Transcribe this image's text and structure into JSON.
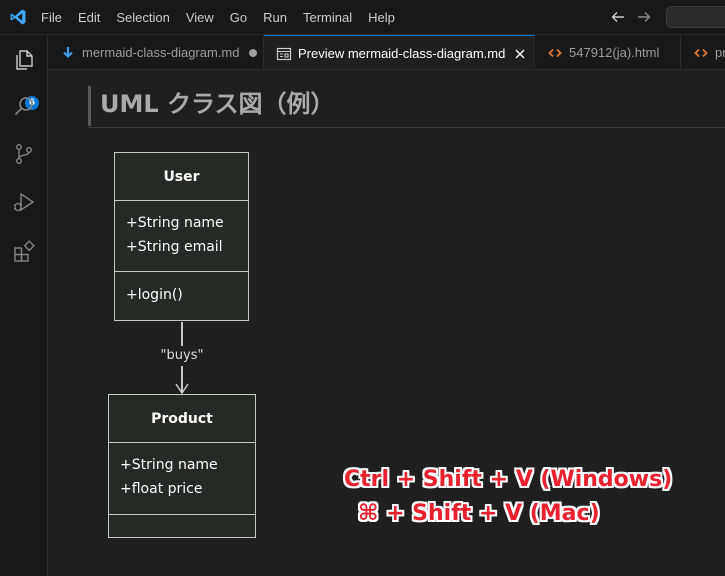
{
  "menu": [
    "File",
    "Edit",
    "Selection",
    "View",
    "Go",
    "Run",
    "Terminal",
    "Help"
  ],
  "activity": {
    "explorer_badge": "6",
    "icons": [
      "files-icon",
      "search-icon",
      "source-control-icon",
      "run-debug-icon",
      "extensions-icon"
    ]
  },
  "tabs": [
    {
      "label": "mermaid-class-diagram.md",
      "icon": "markdown-icon",
      "modified": true,
      "active": false
    },
    {
      "label": "Preview mermaid-class-diagram.md",
      "icon": "preview-icon",
      "active": true
    },
    {
      "label": "547912(ja).html",
      "icon": "html-icon",
      "active": false
    },
    {
      "label": "pr",
      "icon": "html-icon",
      "active": false
    }
  ],
  "preview": {
    "heading": "UML クラス図（例）",
    "classes": [
      {
        "name": "User",
        "attributes": [
          "+String name",
          "+String email"
        ],
        "methods": [
          "+login()"
        ]
      },
      {
        "name": "Product",
        "attributes": [
          "+String name",
          "+float price"
        ],
        "methods": []
      }
    ],
    "relation_label": "\"buys\""
  },
  "annotation": {
    "line1": "Ctrl + Shift + V (Windows)",
    "line2": "⌘ + Shift + V (Mac)",
    "color": "#e8212f"
  },
  "colors": {
    "accent": "#0078d4",
    "background": "#1f1f1f"
  }
}
